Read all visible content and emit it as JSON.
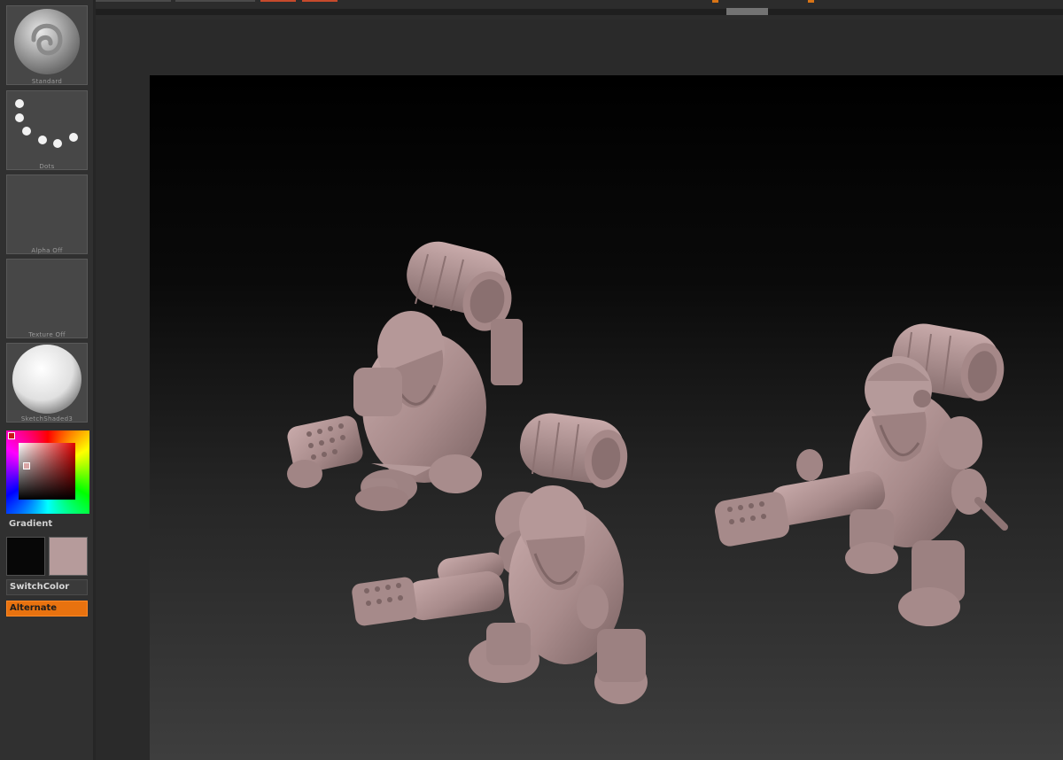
{
  "left_tray": {
    "brush": {
      "label": "Standard",
      "icon": "standard-brush-icon"
    },
    "stroke": {
      "label": "Dots",
      "icon": "dots-stroke-icon"
    },
    "alpha": {
      "label": "Alpha Off"
    },
    "texture": {
      "label": "Texture Off"
    },
    "material": {
      "label": "SketchShaded3",
      "icon": "sphere-material-icon"
    },
    "color": {
      "gradient_label": "Gradient",
      "main_color": "#070707",
      "secondary_color": "#b69b9b",
      "switch_color_label": "SwitchColor",
      "alternate_label": "Alternate"
    }
  },
  "viewport": {
    "model_color": "#b09393",
    "model_shadow": "#6e5757",
    "figures": [
      "dwarf-figure-left",
      "dwarf-figure-center",
      "dwarf-figure-right"
    ]
  },
  "colors": {
    "accent": "#e8720f",
    "ui_background": "#2a2a2a"
  }
}
